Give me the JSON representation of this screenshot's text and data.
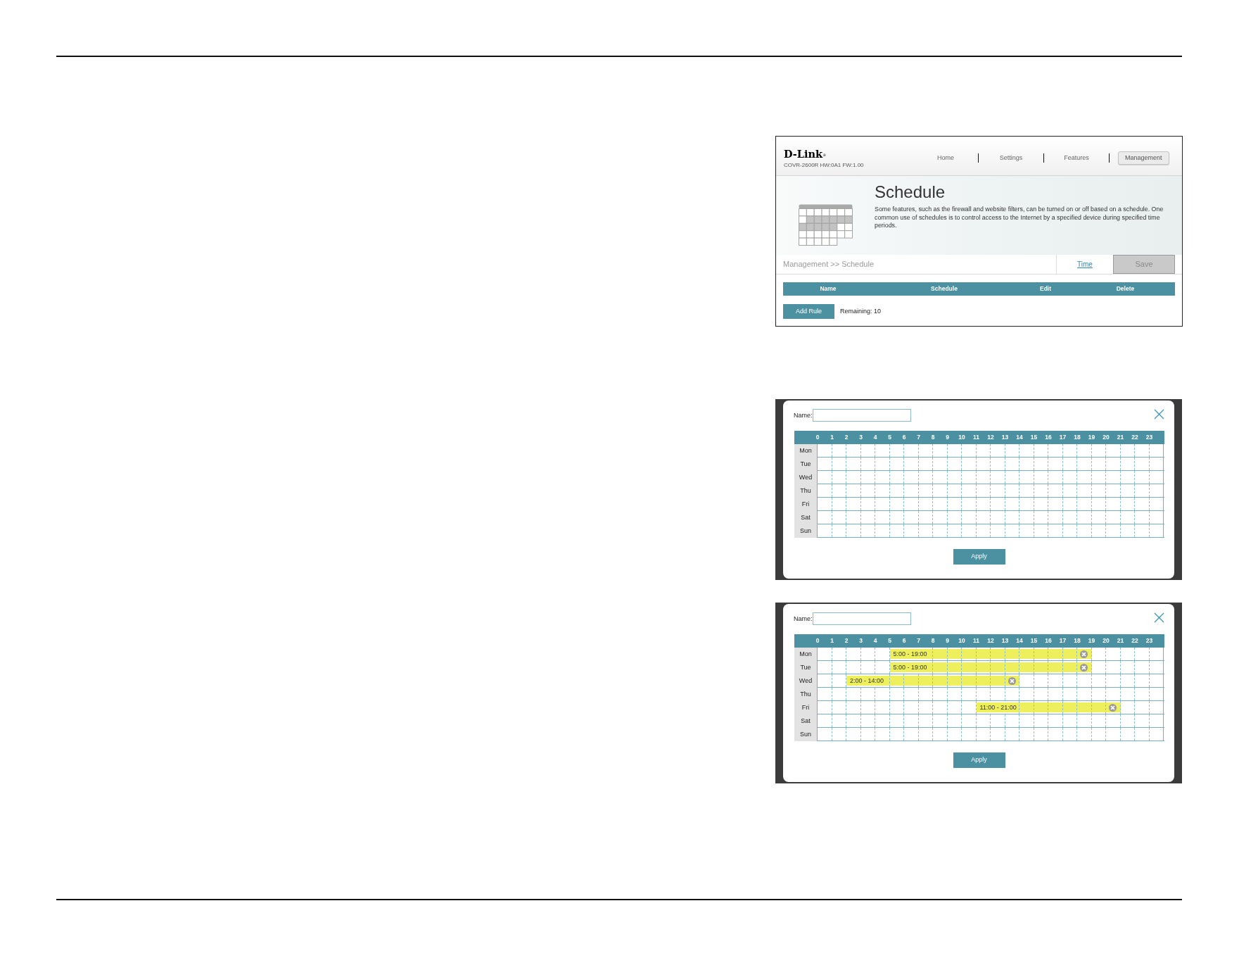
{
  "router_page": {
    "logo": "D-Link$^{®}$",
    "model_info": "COVR-2600R HW:0A1 FW:1.00",
    "nav": [
      {
        "label": "Home",
        "selected": false
      },
      {
        "label": "Settings",
        "selected": false
      },
      {
        "label": "Features",
        "selected": false
      },
      {
        "label": "Management",
        "selected": true
      }
    ],
    "title": "Schedule",
    "description": "Some features, such as the firewall and website filters, can be turned on or off based on a schedule. One common use of schedules is to control access to the Internet by a specified device during specified time periods.",
    "breadcrumb": "Management >> Schedule",
    "time_link": "Time",
    "save_button": {
      "label": "Save",
      "disabled": true
    },
    "table": {
      "columns": [
        "Name",
        "Schedule",
        "Edit",
        "Delete"
      ]
    },
    "add_rule_button": "Add Rule",
    "remaining": "Remaining: 10"
  },
  "schedule_dialogs": [
    {
      "name_label": "Name:",
      "hours": [
        "0",
        "1",
        "2",
        "3",
        "4",
        "5",
        "6",
        "7",
        "8",
        "9",
        "10",
        "11",
        "12",
        "13",
        "14",
        "15",
        "16",
        "17",
        "18",
        "19",
        "20",
        "21",
        "22",
        "23"
      ],
      "days": [
        {
          "label": "Mon",
          "slots": [
            {
              "selected": false
            },
            {
              "selected": false
            },
            {
              "selected": false
            },
            {
              "selected": false
            },
            {
              "selected": false
            },
            {
              "selected": false
            },
            {
              "selected": false
            },
            {
              "selected": false
            },
            {
              "selected": false
            },
            {
              "selected": false
            },
            {
              "selected": false
            },
            {
              "selected": false
            },
            {
              "selected": false
            },
            {
              "selected": false
            },
            {
              "selected": false
            },
            {
              "selected": false
            },
            {
              "selected": false
            },
            {
              "selected": false
            },
            {
              "selected": false
            },
            {
              "selected": false
            },
            {
              "selected": false
            },
            {
              "selected": false
            },
            {
              "selected": false
            },
            {
              "selected": false
            }
          ]
        },
        {
          "label": "Tue",
          "slots": [
            {
              "selected": false
            },
            {
              "selected": false
            },
            {
              "selected": false
            },
            {
              "selected": false
            },
            {
              "selected": false
            },
            {
              "selected": false
            },
            {
              "selected": false
            },
            {
              "selected": false
            },
            {
              "selected": false
            },
            {
              "selected": false
            },
            {
              "selected": false
            },
            {
              "selected": false
            },
            {
              "selected": false
            },
            {
              "selected": false
            },
            {
              "selected": false
            },
            {
              "selected": false
            },
            {
              "selected": false
            },
            {
              "selected": false
            },
            {
              "selected": false
            },
            {
              "selected": false
            },
            {
              "selected": false
            },
            {
              "selected": false
            },
            {
              "selected": false
            },
            {
              "selected": false
            }
          ]
        },
        {
          "label": "Wed",
          "slots": [
            {
              "selected": false
            },
            {
              "selected": false
            },
            {
              "selected": false
            },
            {
              "selected": false
            },
            {
              "selected": false
            },
            {
              "selected": false
            },
            {
              "selected": false
            },
            {
              "selected": false
            },
            {
              "selected": false
            },
            {
              "selected": false
            },
            {
              "selected": false
            },
            {
              "selected": false
            },
            {
              "selected": false
            },
            {
              "selected": false
            },
            {
              "selected": false
            },
            {
              "selected": false
            },
            {
              "selected": false
            },
            {
              "selected": false
            },
            {
              "selected": false
            },
            {
              "selected": false
            },
            {
              "selected": false
            },
            {
              "selected": false
            },
            {
              "selected": false
            },
            {
              "selected": false
            }
          ]
        },
        {
          "label": "Thu",
          "slots": [
            {
              "selected": false
            },
            {
              "selected": false
            },
            {
              "selected": false
            },
            {
              "selected": false
            },
            {
              "selected": false
            },
            {
              "selected": false
            },
            {
              "selected": false
            },
            {
              "selected": false
            },
            {
              "selected": false
            },
            {
              "selected": false
            },
            {
              "selected": false
            },
            {
              "selected": false
            },
            {
              "selected": false
            },
            {
              "selected": false
            },
            {
              "selected": false
            },
            {
              "selected": false
            },
            {
              "selected": false
            },
            {
              "selected": false
            },
            {
              "selected": false
            },
            {
              "selected": false
            },
            {
              "selected": false
            },
            {
              "selected": false
            },
            {
              "selected": false
            },
            {
              "selected": false
            }
          ]
        },
        {
          "label": "Fri",
          "slots": [
            {
              "selected": false
            },
            {
              "selected": false
            },
            {
              "selected": false
            },
            {
              "selected": false
            },
            {
              "selected": false
            },
            {
              "selected": false
            },
            {
              "selected": false
            },
            {
              "selected": false
            },
            {
              "selected": false
            },
            {
              "selected": false
            },
            {
              "selected": false
            },
            {
              "selected": false
            },
            {
              "selected": false
            },
            {
              "selected": false
            },
            {
              "selected": false
            },
            {
              "selected": false
            },
            {
              "selected": false
            },
            {
              "selected": false
            },
            {
              "selected": false
            },
            {
              "selected": false
            },
            {
              "selected": false
            },
            {
              "selected": false
            },
            {
              "selected": false
            },
            {
              "selected": false
            }
          ]
        },
        {
          "label": "Sat",
          "slots": [
            {
              "selected": false
            },
            {
              "selected": false
            },
            {
              "selected": false
            },
            {
              "selected": false
            },
            {
              "selected": false
            },
            {
              "selected": false
            },
            {
              "selected": false
            },
            {
              "selected": false
            },
            {
              "selected": false
            },
            {
              "selected": false
            },
            {
              "selected": false
            },
            {
              "selected": false
            },
            {
              "selected": false
            },
            {
              "selected": false
            },
            {
              "selected": false
            },
            {
              "selected": false
            },
            {
              "selected": false
            },
            {
              "selected": false
            },
            {
              "selected": false
            },
            {
              "selected": false
            },
            {
              "selected": false
            },
            {
              "selected": false
            },
            {
              "selected": false
            },
            {
              "selected": false
            }
          ]
        },
        {
          "label": "Sun",
          "slots": [
            {
              "selected": false
            },
            {
              "selected": false
            },
            {
              "selected": false
            },
            {
              "selected": false
            },
            {
              "selected": false
            },
            {
              "selected": false
            },
            {
              "selected": false
            },
            {
              "selected": false
            },
            {
              "selected": false
            },
            {
              "selected": false
            },
            {
              "selected": false
            },
            {
              "selected": false
            },
            {
              "selected": false
            },
            {
              "selected": false
            },
            {
              "selected": false
            },
            {
              "selected": false
            },
            {
              "selected": false
            },
            {
              "selected": false
            },
            {
              "selected": false
            },
            {
              "selected": false
            },
            {
              "selected": false
            },
            {
              "selected": false
            },
            {
              "selected": false
            },
            {
              "selected": false
            }
          ]
        }
      ],
      "apply_button": "Apply"
    },
    {
      "name_label": "Name:",
      "hours": [
        "0",
        "1",
        "2",
        "3",
        "4",
        "5",
        "6",
        "7",
        "8",
        "9",
        "10",
        "11",
        "12",
        "13",
        "14",
        "15",
        "16",
        "17",
        "18",
        "19",
        "20",
        "21",
        "22",
        "23"
      ],
      "days": [
        {
          "label": "Mon",
          "range": {
            "label": "5:00 - 19:00"
          },
          "slots": [
            {
              "selected": false
            },
            {
              "selected": false
            },
            {
              "selected": false
            },
            {
              "selected": false
            },
            {
              "selected": false
            },
            {
              "selected": true
            },
            {
              "selected": true
            },
            {
              "selected": true
            },
            {
              "selected": true
            },
            {
              "selected": true
            },
            {
              "selected": true
            },
            {
              "selected": true
            },
            {
              "selected": true
            },
            {
              "selected": true
            },
            {
              "selected": true
            },
            {
              "selected": true
            },
            {
              "selected": true
            },
            {
              "selected": true
            },
            {
              "selected": true
            },
            {
              "selected": false
            },
            {
              "selected": false
            },
            {
              "selected": false
            },
            {
              "selected": false
            },
            {
              "selected": false
            }
          ]
        },
        {
          "label": "Tue",
          "range": {
            "label": "5:00 - 19:00"
          },
          "slots": [
            {
              "selected": false
            },
            {
              "selected": false
            },
            {
              "selected": false
            },
            {
              "selected": false
            },
            {
              "selected": false
            },
            {
              "selected": true
            },
            {
              "selected": true
            },
            {
              "selected": true
            },
            {
              "selected": true
            },
            {
              "selected": true
            },
            {
              "selected": true
            },
            {
              "selected": true
            },
            {
              "selected": true
            },
            {
              "selected": true
            },
            {
              "selected": true
            },
            {
              "selected": true
            },
            {
              "selected": true
            },
            {
              "selected": true
            },
            {
              "selected": true
            },
            {
              "selected": false
            },
            {
              "selected": false
            },
            {
              "selected": false
            },
            {
              "selected": false
            },
            {
              "selected": false
            }
          ]
        },
        {
          "label": "Wed",
          "range": {
            "label": "2:00 - 14:00"
          },
          "slots": [
            {
              "selected": false
            },
            {
              "selected": false
            },
            {
              "selected": true
            },
            {
              "selected": true
            },
            {
              "selected": true
            },
            {
              "selected": true
            },
            {
              "selected": true
            },
            {
              "selected": true
            },
            {
              "selected": true
            },
            {
              "selected": true
            },
            {
              "selected": true
            },
            {
              "selected": true
            },
            {
              "selected": true
            },
            {
              "selected": true
            },
            {
              "selected": false
            },
            {
              "selected": false
            },
            {
              "selected": false
            },
            {
              "selected": false
            },
            {
              "selected": false
            },
            {
              "selected": false
            },
            {
              "selected": false
            },
            {
              "selected": false
            },
            {
              "selected": false
            },
            {
              "selected": false
            }
          ]
        },
        {
          "label": "Thu",
          "slots": [
            {
              "selected": false
            },
            {
              "selected": false
            },
            {
              "selected": false
            },
            {
              "selected": false
            },
            {
              "selected": false
            },
            {
              "selected": false
            },
            {
              "selected": false
            },
            {
              "selected": false
            },
            {
              "selected": false
            },
            {
              "selected": false
            },
            {
              "selected": false
            },
            {
              "selected": false
            },
            {
              "selected": false
            },
            {
              "selected": false
            },
            {
              "selected": false
            },
            {
              "selected": false
            },
            {
              "selected": false
            },
            {
              "selected": false
            },
            {
              "selected": false
            },
            {
              "selected": false
            },
            {
              "selected": false
            },
            {
              "selected": false
            },
            {
              "selected": false
            },
            {
              "selected": false
            }
          ]
        },
        {
          "label": "Fri",
          "range": {
            "label": "11:00 - 21:00"
          },
          "slots": [
            {
              "selected": false
            },
            {
              "selected": false
            },
            {
              "selected": false
            },
            {
              "selected": false
            },
            {
              "selected": false
            },
            {
              "selected": false
            },
            {
              "selected": false
            },
            {
              "selected": false
            },
            {
              "selected": false
            },
            {
              "selected": false
            },
            {
              "selected": false
            },
            {
              "selected": true
            },
            {
              "selected": true
            },
            {
              "selected": true
            },
            {
              "selected": true
            },
            {
              "selected": true
            },
            {
              "selected": true
            },
            {
              "selected": true
            },
            {
              "selected": true
            },
            {
              "selected": true
            },
            {
              "selected": true
            },
            {
              "selected": false
            },
            {
              "selected": false
            },
            {
              "selected": false
            }
          ]
        },
        {
          "label": "Sat",
          "slots": [
            {
              "selected": false
            },
            {
              "selected": false
            },
            {
              "selected": false
            },
            {
              "selected": false
            },
            {
              "selected": false
            },
            {
              "selected": false
            },
            {
              "selected": false
            },
            {
              "selected": false
            },
            {
              "selected": false
            },
            {
              "selected": false
            },
            {
              "selected": false
            },
            {
              "selected": false
            },
            {
              "selected": false
            },
            {
              "selected": false
            },
            {
              "selected": false
            },
            {
              "selected": false
            },
            {
              "selected": false
            },
            {
              "selected": false
            },
            {
              "selected": false
            },
            {
              "selected": false
            },
            {
              "selected": false
            },
            {
              "selected": false
            },
            {
              "selected": false
            },
            {
              "selected": false
            }
          ]
        },
        {
          "label": "Sun",
          "slots": [
            {
              "selected": false
            },
            {
              "selected": false
            },
            {
              "selected": false
            },
            {
              "selected": false
            },
            {
              "selected": false
            },
            {
              "selected": false
            },
            {
              "selected": false
            },
            {
              "selected": false
            },
            {
              "selected": false
            },
            {
              "selected": false
            },
            {
              "selected": false
            },
            {
              "selected": false
            },
            {
              "selected": false
            },
            {
              "selected": false
            },
            {
              "selected": false
            },
            {
              "selected": false
            },
            {
              "selected": false
            },
            {
              "selected": false
            },
            {
              "selected": false
            },
            {
              "selected": false
            },
            {
              "selected": false
            },
            {
              "selected": false
            },
            {
              "selected": false
            },
            {
              "selected": false
            }
          ]
        }
      ],
      "apply_button": "Apply"
    }
  ]
}
